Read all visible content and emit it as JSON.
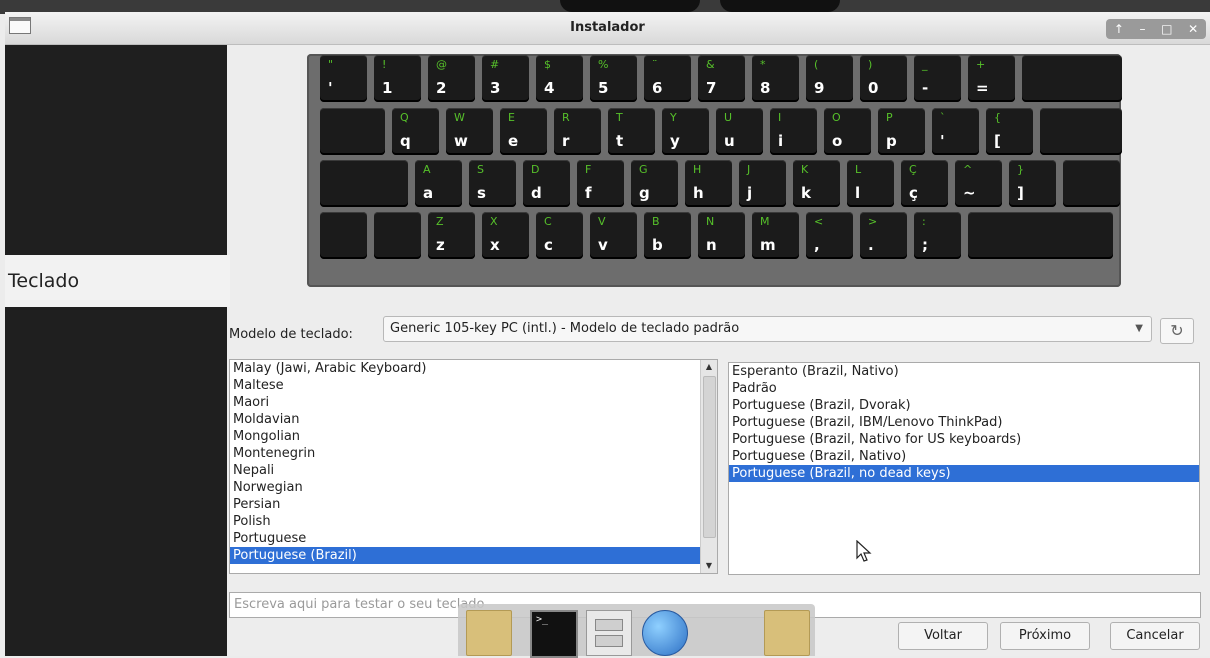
{
  "window": {
    "title": "Instalador",
    "controls": [
      "↑",
      "–",
      "□",
      "✕"
    ]
  },
  "sidebar": {
    "active_label": "Teclado"
  },
  "keyboard": {
    "rows": [
      [
        {
          "s": "\"",
          "b": "'"
        },
        {
          "s": "!",
          "b": "1"
        },
        {
          "s": "@",
          "b": "2"
        },
        {
          "s": "#",
          "b": "3"
        },
        {
          "s": "$",
          "b": "4"
        },
        {
          "s": "%",
          "b": "5"
        },
        {
          "s": "¨",
          "b": "6"
        },
        {
          "s": "&",
          "b": "7"
        },
        {
          "s": "*",
          "b": "8"
        },
        {
          "s": "(",
          "b": "9"
        },
        {
          "s": ")",
          "b": "0"
        },
        {
          "s": "_",
          "b": "-"
        },
        {
          "s": "+",
          "b": "="
        },
        {
          "s": "",
          "b": ""
        }
      ],
      [
        {
          "s": "",
          "b": ""
        },
        {
          "s": "Q",
          "b": "q"
        },
        {
          "s": "W",
          "b": "w"
        },
        {
          "s": "E",
          "b": "e"
        },
        {
          "s": "R",
          "b": "r"
        },
        {
          "s": "T",
          "b": "t"
        },
        {
          "s": "Y",
          "b": "y"
        },
        {
          "s": "U",
          "b": "u"
        },
        {
          "s": "I",
          "b": "i"
        },
        {
          "s": "O",
          "b": "o"
        },
        {
          "s": "P",
          "b": "p"
        },
        {
          "s": "`",
          "b": "'"
        },
        {
          "s": "{",
          "b": "["
        },
        {
          "s": "",
          "b": ""
        }
      ],
      [
        {
          "s": "",
          "b": ""
        },
        {
          "s": "A",
          "b": "a"
        },
        {
          "s": "S",
          "b": "s"
        },
        {
          "s": "D",
          "b": "d"
        },
        {
          "s": "F",
          "b": "f"
        },
        {
          "s": "G",
          "b": "g"
        },
        {
          "s": "H",
          "b": "h"
        },
        {
          "s": "J",
          "b": "j"
        },
        {
          "s": "K",
          "b": "k"
        },
        {
          "s": "L",
          "b": "l"
        },
        {
          "s": "Ç",
          "b": "ç"
        },
        {
          "s": "^",
          "b": "~"
        },
        {
          "s": "}",
          "b": "]"
        },
        {
          "s": "",
          "b": ""
        }
      ],
      [
        {
          "s": "",
          "b": ""
        },
        {
          "s": "",
          "b": ""
        },
        {
          "s": "Z",
          "b": "z"
        },
        {
          "s": "X",
          "b": "x"
        },
        {
          "s": "C",
          "b": "c"
        },
        {
          "s": "V",
          "b": "v"
        },
        {
          "s": "B",
          "b": "b"
        },
        {
          "s": "N",
          "b": "n"
        },
        {
          "s": "M",
          "b": "m"
        },
        {
          "s": "<",
          "b": ","
        },
        {
          "s": ">",
          "b": "."
        },
        {
          "s": ":",
          "b": ";"
        },
        {
          "s": "",
          "b": ""
        }
      ]
    ]
  },
  "model": {
    "label": "Modelo de teclado:",
    "value": "Generic 105-key PC (intl.)  -  Modelo de teclado padrão"
  },
  "layouts": [
    "Malay (Jawi, Arabic Keyboard)",
    "Maltese",
    "Maori",
    "Moldavian",
    "Mongolian",
    "Montenegrin",
    "Nepali",
    "Norwegian",
    "Persian",
    "Polish",
    "Portuguese",
    "Portuguese (Brazil)"
  ],
  "layouts_selected": 11,
  "variants": [
    "Esperanto (Brazil, Nativo)",
    "Padrão",
    "Portuguese (Brazil, Dvorak)",
    "Portuguese (Brazil, IBM/Lenovo ThinkPad)",
    "Portuguese (Brazil, Nativo for US keyboards)",
    "Portuguese (Brazil, Nativo)",
    "Portuguese (Brazil, no dead keys)"
  ],
  "variants_selected": 6,
  "test_placeholder": "Escreva aqui para testar o seu teclado",
  "buttons": {
    "back": "Voltar",
    "next": "Próximo",
    "cancel": "Cancelar"
  },
  "dock": [
    "folder-icon",
    "terminal-icon",
    "file-cabinet-icon",
    "globe-icon",
    "folder-icon"
  ]
}
